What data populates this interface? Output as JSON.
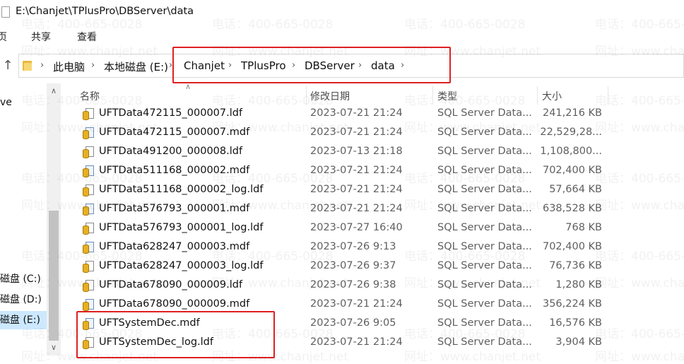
{
  "window": {
    "title": "E:\\Chanjet\\TPlusPro\\DBServer\\data"
  },
  "ribbon": {
    "tabs": [
      "页",
      "共享",
      "查看"
    ]
  },
  "address": {
    "crumbs": [
      "此电脑",
      "本地磁盘 (E:)",
      "Chanjet",
      "TPlusPro",
      "DBServer",
      "data"
    ]
  },
  "nav": {
    "items": [
      {
        "label": "ve",
        "selected": false
      },
      {
        "label": "磁盘 (C:)",
        "selected": false
      },
      {
        "label": "磁盘 (D:)",
        "selected": false
      },
      {
        "label": "磁盘 (E:)",
        "selected": true
      }
    ],
    "scroll_up": "∧",
    "scroll_down": "∨"
  },
  "columns": {
    "name": "名称",
    "date": "修改日期",
    "type": "类型",
    "size": "大小",
    "sort_indicator": "∧"
  },
  "files": [
    {
      "name": "UFTData472115_000007.ldf",
      "date": "2023-07-21 21:24",
      "type": "SQL Server Data...",
      "size": "241,216 KB",
      "kind": "ldf"
    },
    {
      "name": "UFTData472115_000007.mdf",
      "date": "2023-07-21 21:24",
      "type": "SQL Server Data...",
      "size": "22,529,28...",
      "kind": "mdf"
    },
    {
      "name": "UFTData491200_000008.ldf",
      "date": "2023-07-13 21:18",
      "type": "SQL Server Data...",
      "size": "1,108,800...",
      "kind": "ldf"
    },
    {
      "name": "UFTData511168_000002.mdf",
      "date": "2023-07-21 21:24",
      "type": "SQL Server Data...",
      "size": "702,400 KB",
      "kind": "mdf"
    },
    {
      "name": "UFTData511168_000002_log.ldf",
      "date": "2023-07-21 21:24",
      "type": "SQL Server Data...",
      "size": "57,664 KB",
      "kind": "ldf"
    },
    {
      "name": "UFTData576793_000001.mdf",
      "date": "2023-07-21 21:24",
      "type": "SQL Server Data...",
      "size": "638,528 KB",
      "kind": "mdf"
    },
    {
      "name": "UFTData576793_000001_log.ldf",
      "date": "2023-07-27 16:40",
      "type": "SQL Server Data...",
      "size": "768 KB",
      "kind": "ldf"
    },
    {
      "name": "UFTData628247_000003.mdf",
      "date": "2023-07-26 9:13",
      "type": "SQL Server Data...",
      "size": "702,400 KB",
      "kind": "mdf"
    },
    {
      "name": "UFTData628247_000003_log.ldf",
      "date": "2023-07-26 9:37",
      "type": "SQL Server Data...",
      "size": "76,736 KB",
      "kind": "ldf"
    },
    {
      "name": "UFTData678090_000009.ldf",
      "date": "2023-07-26 9:38",
      "type": "SQL Server Data...",
      "size": "1,280 KB",
      "kind": "ldf"
    },
    {
      "name": "UFTData678090_000009.mdf",
      "date": "2023-07-21 21:24",
      "type": "SQL Server Data...",
      "size": "356,224 KB",
      "kind": "mdf"
    },
    {
      "name": "UFTSystemDec.mdf",
      "date": "2023-07-26 9:05",
      "type": "SQL Server Data...",
      "size": "16,576 KB",
      "kind": "mdf"
    },
    {
      "name": "UFTSystemDec_log.ldf",
      "date": "2023-07-21 21:24",
      "type": "SQL Server Data...",
      "size": "3,904 KB",
      "kind": "ldf"
    }
  ],
  "watermark": {
    "phone": "电话：400-665-0028",
    "site": "网址：www.chanjet.net"
  },
  "colors": {
    "highlight_red": "#e02020",
    "selected_nav": "#cce8ff"
  }
}
